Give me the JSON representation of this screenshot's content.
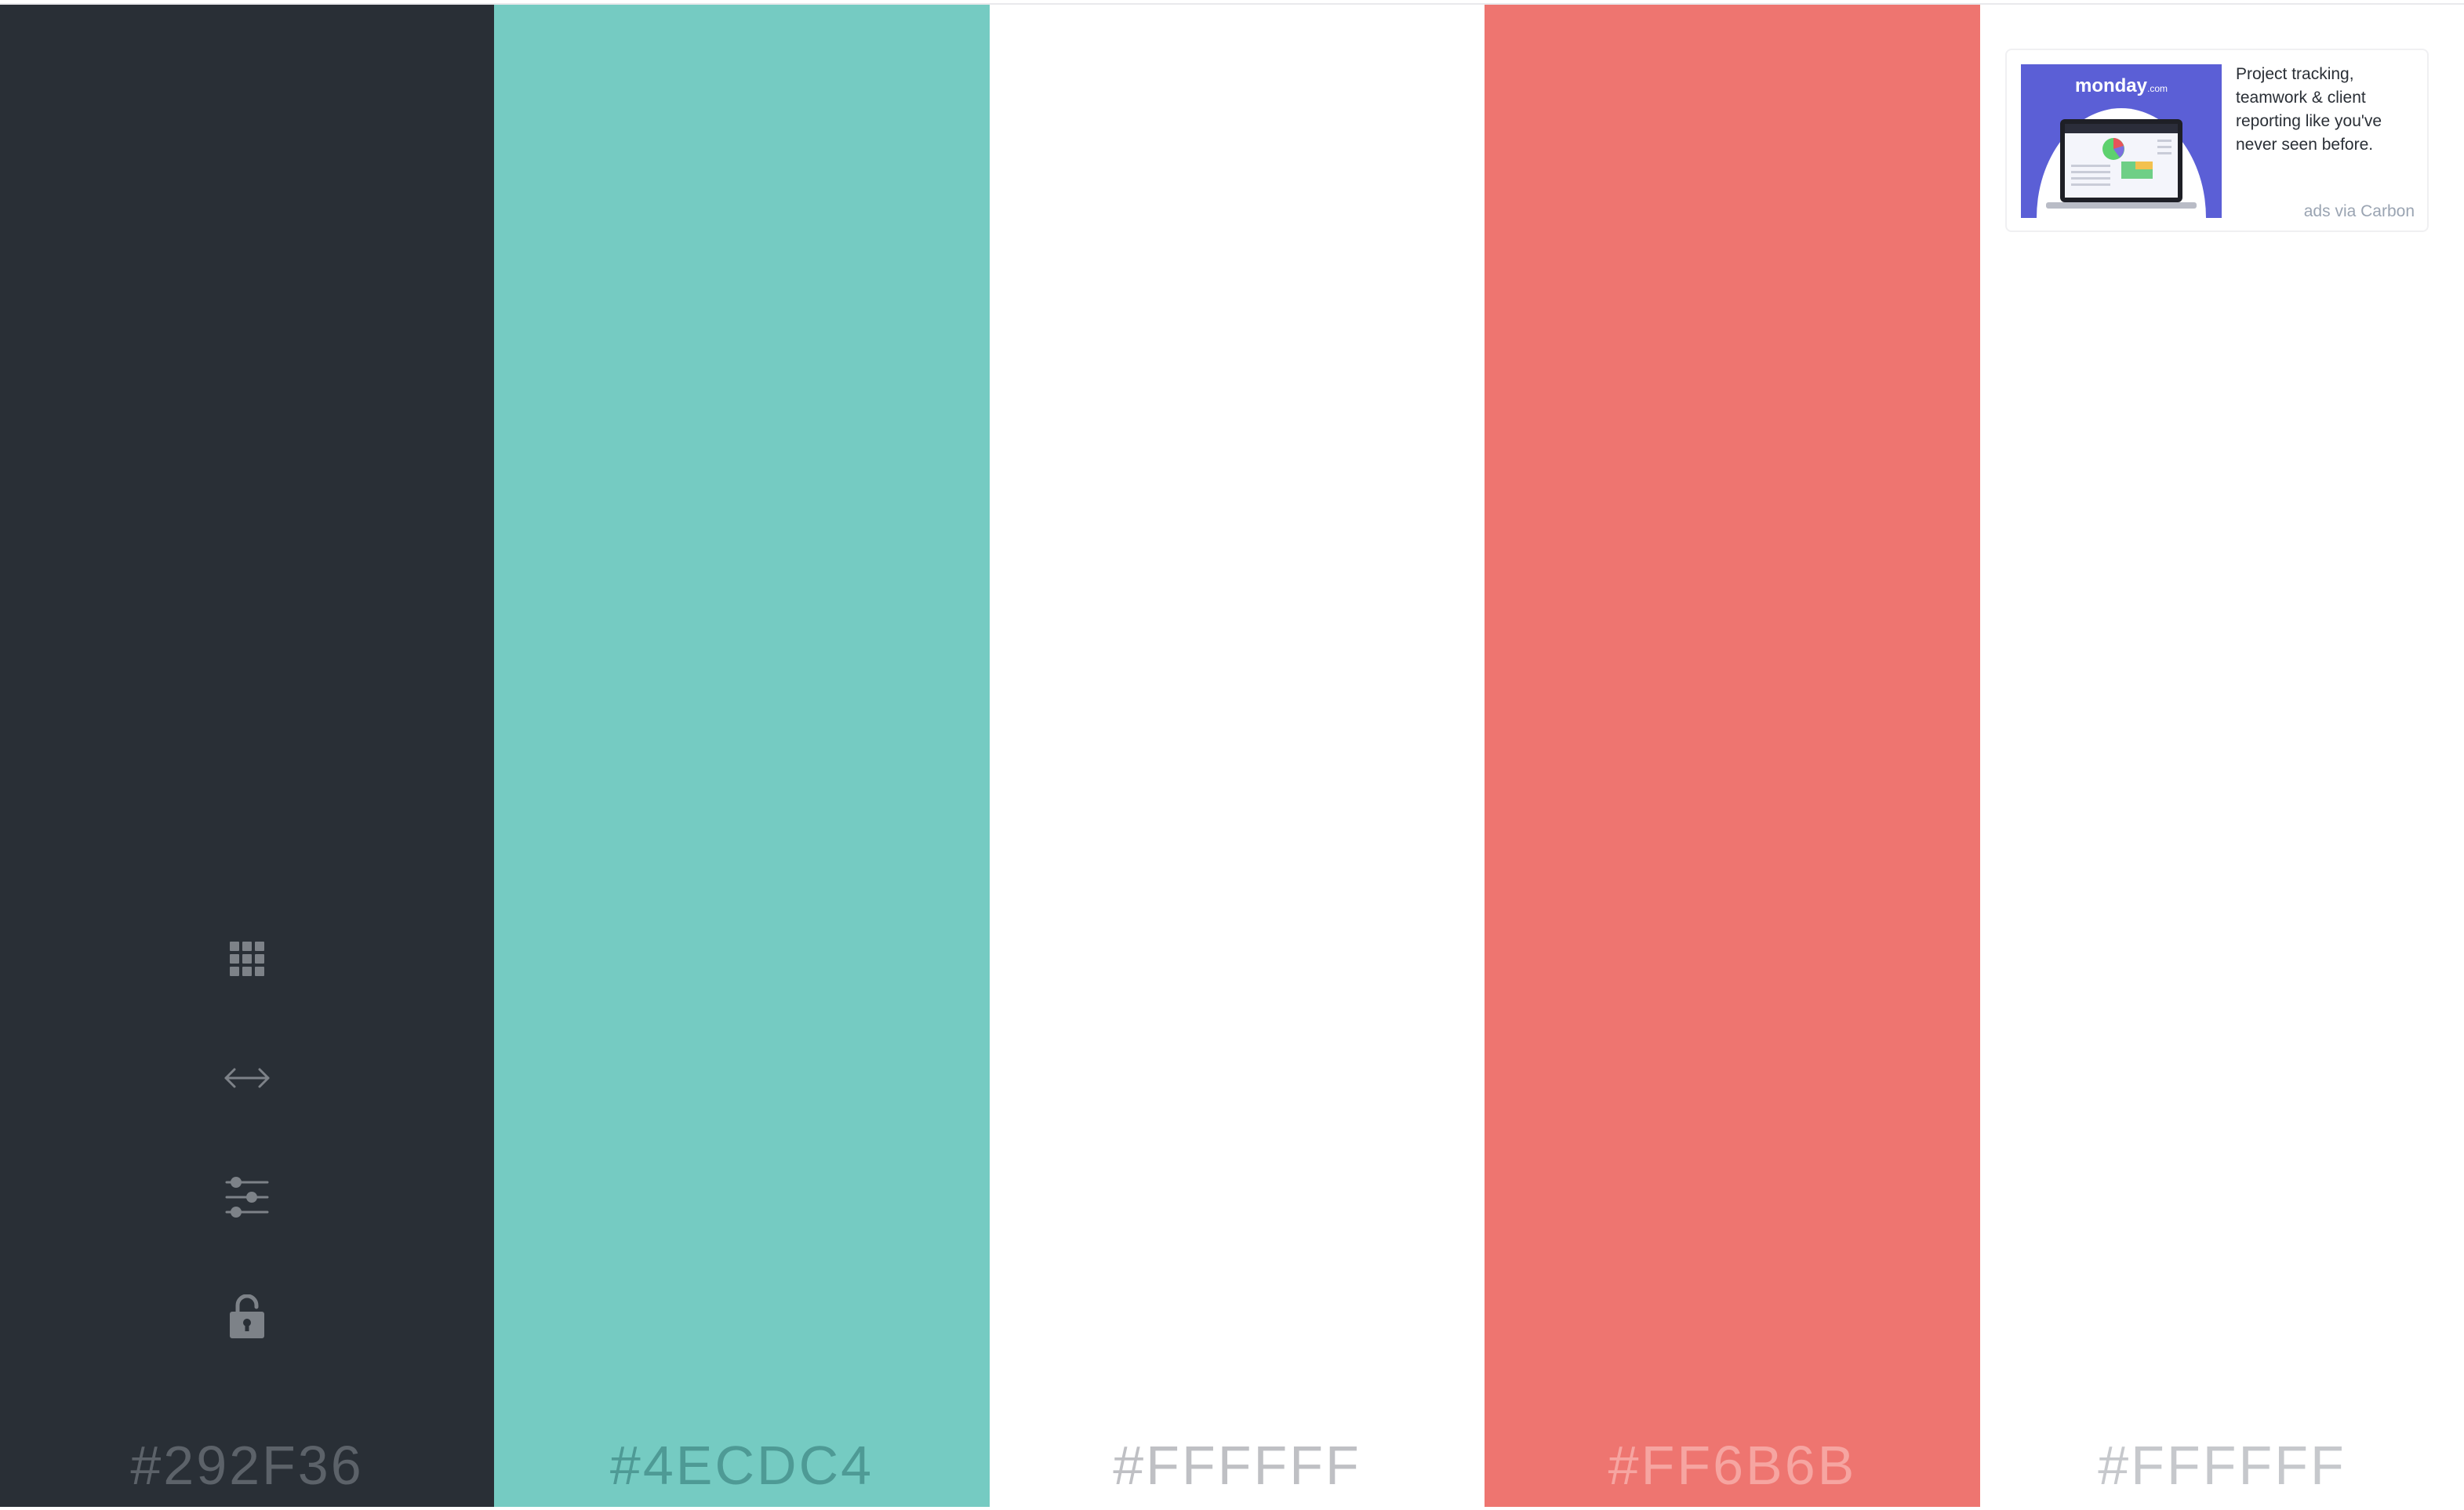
{
  "palette": {
    "colors": [
      {
        "hex": "#292F36",
        "background": "#292F36",
        "label_color": "#5c6269"
      },
      {
        "hex": "#4ECDC4",
        "background": "#75CBC2",
        "label_color": "#4e9a95"
      },
      {
        "hex": "#FFFFFF",
        "background": "#FFFFFF",
        "label_color": "#bfc0c4"
      },
      {
        "hex": "#FF6B6B",
        "background": "#EE7570",
        "label_color": "#f6a5a1"
      },
      {
        "hex": "#FFFFFF",
        "background": "#FFFFFF",
        "label_color": "#c6c8cc"
      }
    ]
  },
  "toolbar": {
    "icon_color": "#7d8288",
    "tools": [
      {
        "icon": "grid-icon"
      },
      {
        "icon": "resize-horizontal-icon"
      },
      {
        "icon": "sliders-icon"
      },
      {
        "icon": "unlock-icon"
      }
    ]
  },
  "ad": {
    "brand": "monday",
    "brand_suffix": ".com",
    "text": "Project tracking, teamwork & client reporting like you've never seen before.",
    "via": "ads via Carbon"
  }
}
